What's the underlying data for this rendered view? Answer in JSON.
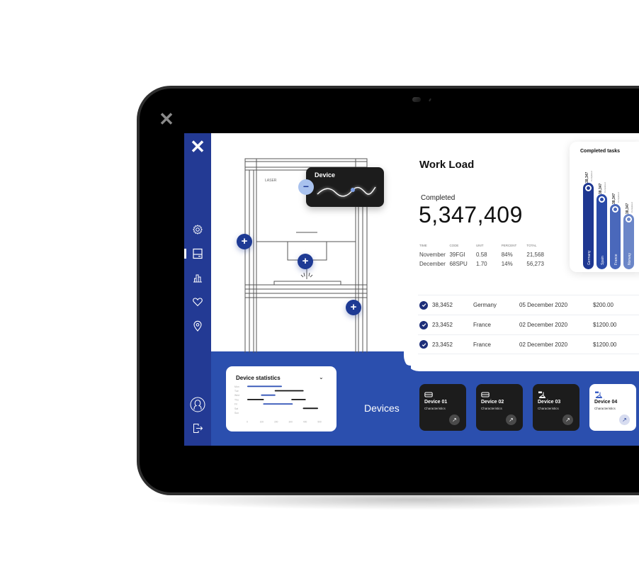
{
  "colors": {
    "brand_blue": "#233a94",
    "band_blue": "#2b4fae",
    "dark_card": "#1c1c1c",
    "bar_colors": [
      "#1e3791",
      "#2a4aa8",
      "#4a68bb",
      "#6b86c8"
    ]
  },
  "sidebar": {
    "close_icon": "close-icon",
    "items": [
      {
        "name": "settings",
        "icon": "gear-icon"
      },
      {
        "name": "devices",
        "icon": "panel-icon",
        "active": true
      },
      {
        "name": "analytics",
        "icon": "bar-chart-icon"
      },
      {
        "name": "favorites",
        "icon": "heart-icon"
      },
      {
        "name": "location",
        "icon": "map-pin-icon"
      }
    ],
    "avatar_icon": "user-avatar-icon",
    "logout_icon": "logout-icon"
  },
  "machine": {
    "module_label": "LASER",
    "popup_title": "Device",
    "minus_symbol": "−",
    "plus_symbol": "+"
  },
  "workload": {
    "title": "Work Load",
    "completed_label": "Completed",
    "completed_value": "5,347,409",
    "table": {
      "headers": [
        "TIME",
        "CODE",
        "UNIT",
        "PERCENT",
        "TOTAL"
      ],
      "rows": [
        [
          "November",
          "39FGI",
          "0.58",
          "84%",
          "21,568"
        ],
        [
          "December",
          "68SPU",
          "1.70",
          "14%",
          "56,273"
        ]
      ]
    }
  },
  "completed_tasks": {
    "title": "Completed tasks",
    "caption": "Completed",
    "bars": [
      {
        "country": "Germany",
        "value_label": "38,347",
        "relative_height": 1.0
      },
      {
        "country": "Spain",
        "value_label": "38,347",
        "relative_height": 0.87
      },
      {
        "country": "France",
        "value_label": "38,347",
        "relative_height": 0.75
      },
      {
        "country": "Norway",
        "value_label": "38,347",
        "relative_height": 0.64
      }
    ]
  },
  "transactions": [
    {
      "id": "38,3452",
      "country": "Germany",
      "date": "05 December 2020",
      "amount": "$200.00"
    },
    {
      "id": "23,3452",
      "country": "France",
      "date": "02 December 2020",
      "amount": "$1200.00"
    },
    {
      "id": "23,3452",
      "country": "France",
      "date": "02 December 2020",
      "amount": "$1200.00"
    }
  ],
  "device_statistics": {
    "title": "Device statistics",
    "chevron": "⌄",
    "days": [
      "Mon",
      "Tue",
      "Wed",
      "Thu",
      "Fri",
      "Sat",
      "Sun"
    ],
    "x_ticks": [
      "0",
      "100",
      "200",
      "300",
      "400",
      "500"
    ],
    "x_range": [
      0,
      500
    ],
    "segments": [
      {
        "day": "Mon",
        "start": 0,
        "end": 240,
        "color": "blue"
      },
      {
        "day": "Tue",
        "start": 190,
        "end": 390,
        "color": "black"
      },
      {
        "day": "Wed",
        "start": 95,
        "end": 195,
        "color": "blue"
      },
      {
        "day": "Thu",
        "start": 0,
        "end": 115,
        "color": "black"
      },
      {
        "day": "Thu",
        "start": 305,
        "end": 405,
        "color": "black"
      },
      {
        "day": "Fri",
        "start": 110,
        "end": 315,
        "color": "blue"
      },
      {
        "day": "Sat",
        "start": 385,
        "end": 490,
        "color": "black"
      }
    ]
  },
  "devices": {
    "label": "Devices",
    "cards": [
      {
        "name": "Device 01",
        "sub": "Characteristics",
        "icon": "printer-icon",
        "theme": "dark"
      },
      {
        "name": "Device 02",
        "sub": "Characteristics",
        "icon": "printer-icon",
        "theme": "dark"
      },
      {
        "name": "Device 03",
        "sub": "Characteristics",
        "icon": "robot-arm-icon",
        "theme": "dark"
      },
      {
        "name": "Device 04",
        "sub": "Characteristics",
        "icon": "robot-arm-icon",
        "theme": "light"
      }
    ],
    "open_symbol": "↗"
  }
}
